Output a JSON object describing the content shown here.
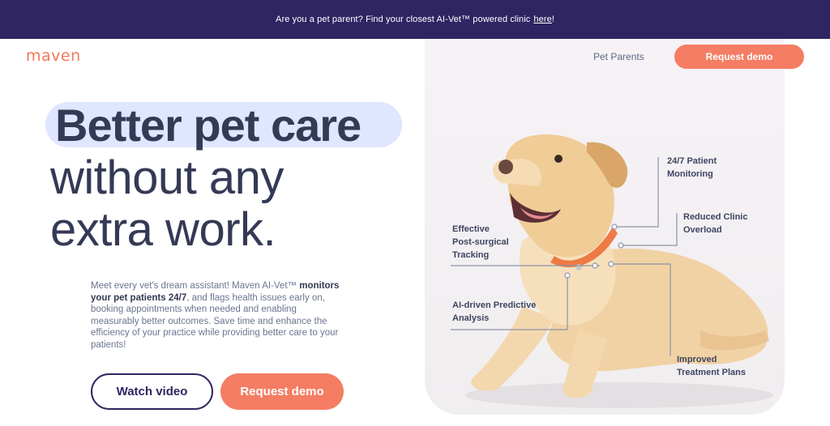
{
  "announcement": {
    "text": "Are you a pet parent? Find your closest AI-Vet™ powered clinic",
    "link": "here",
    "tail": "!"
  },
  "header": {
    "logo": "maven",
    "nav_link": "Pet Parents",
    "cta": "Request demo"
  },
  "hero": {
    "headline_1": "Better pet care",
    "headline_2": "without any",
    "headline_3": "extra work.",
    "desc_1": "Meet every vet's dream assistant! Maven AI-Vet™",
    "desc_bold": "monitors your pet patients 24/7",
    "desc_2": ", and flags health issues early on, booking appointments when needed and enabling measurably better outcomes. Save time and enhance the efficiency of your practice while providing better care to your patients!",
    "watch_video": "Watch video",
    "request_demo": "Request demo"
  },
  "callouts": {
    "monitoring_1": "24/7 Patient",
    "monitoring_2": "Monitoring",
    "overload_1": "Reduced Clinic",
    "overload_2": "Overload",
    "tracking_1": "Effective",
    "tracking_2": "Post-surgical",
    "tracking_3": "Tracking",
    "predictive_1": "AI-driven Predictive",
    "predictive_2": "Analysis",
    "treatment_1": "Improved",
    "treatment_2": "Treatment Plans"
  },
  "colors": {
    "banner": "#2e2562",
    "accent": "#f47d63",
    "headline_highlight": "#dfe6ff",
    "text_dark": "#343a55"
  }
}
